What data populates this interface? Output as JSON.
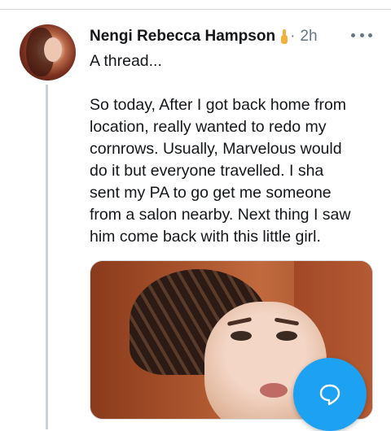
{
  "tweet": {
    "author": "Nengi Rebecca Hampson",
    "author_emoji": "candle-emoji",
    "separator": "·",
    "time": "2h",
    "text_first": "A thread...",
    "text_lines": [
      "So today, After I got back home from",
      "location, really wanted to redo my",
      "cornrows. Usually, Marvelous would",
      "do it but everyone travelled. I sha",
      "sent my PA to go get me someone",
      "from a salon nearby. Next thing I saw",
      "him come back with this little girl."
    ]
  },
  "icons": {
    "more": "more-icon",
    "compose": "chat-bubble-icon"
  },
  "colors": {
    "accent": "#1da1f2",
    "secondary_text": "#657786",
    "thread_line": "#c9d2d9"
  }
}
